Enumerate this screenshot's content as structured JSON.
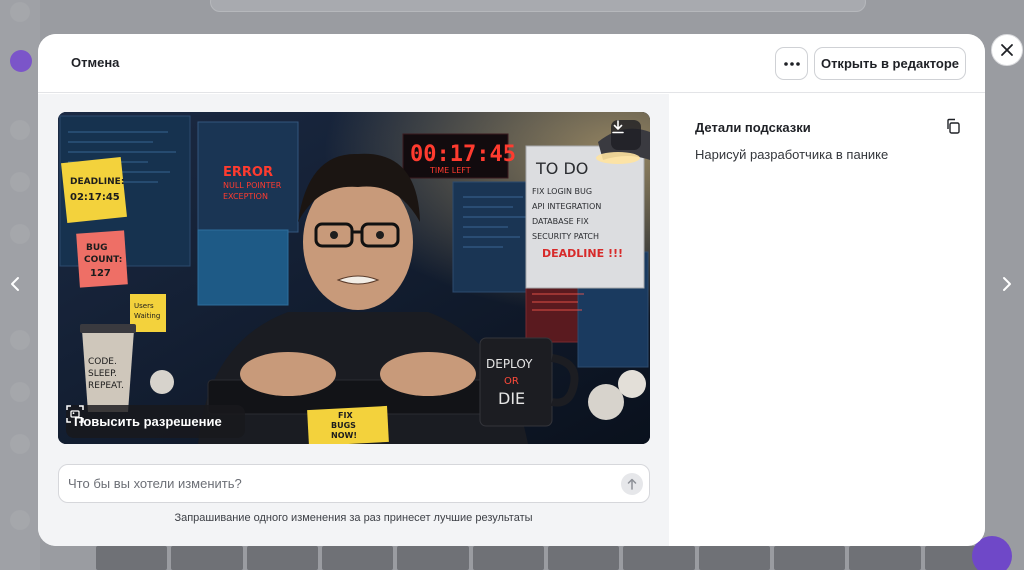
{
  "header": {
    "cancel_label": "Отмена",
    "open_editor_label": "Открыть в редакторе"
  },
  "image": {
    "alt": "Нарисуй разработчика в панике",
    "upscale_label": "Повысить разрешение",
    "scene_text": {
      "timer": "00:17:45",
      "timer_caption": "TIME LEFT",
      "error_title": "ERROR",
      "error_line1": "NULL POINTER",
      "error_line2": "EXCEPTION",
      "note_deadline_1": "DEADLINE:",
      "note_deadline_2": "02:17:45",
      "note_bug_1": "BUG",
      "note_bug_2": "COUNT:",
      "note_bug_3": "127",
      "note_users_1": "Users",
      "note_users_2": "Waiting",
      "note_fix_1": "FIX",
      "note_fix_2": "BUGS",
      "note_fix_3": "NOW!",
      "todo_title": "TO DO",
      "todo_1": "FIX LOGIN BUG",
      "todo_2": "API INTEGRATION",
      "todo_3": "DATABASE FIX",
      "todo_4": "SECURITY PATCH",
      "todo_deadline": "DEADLINE !!!",
      "mug_1": "DEPLOY",
      "mug_2": "OR",
      "mug_3": "DIE",
      "cup_1": "CODE.",
      "cup_2": "SLEEP.",
      "cup_3": "REPEAT."
    }
  },
  "composer": {
    "placeholder": "Что бы вы хотели изменить?",
    "hint": "Запрашивание одного изменения за раз принесет лучшие результаты"
  },
  "details": {
    "title": "Детали подсказки",
    "prompt": "Нарисуй разработчика в панике"
  },
  "colors": {
    "accent_purple": "#6f48c8",
    "timer_red": "#ff3b2f",
    "note_yellow": "#f3d23c"
  }
}
